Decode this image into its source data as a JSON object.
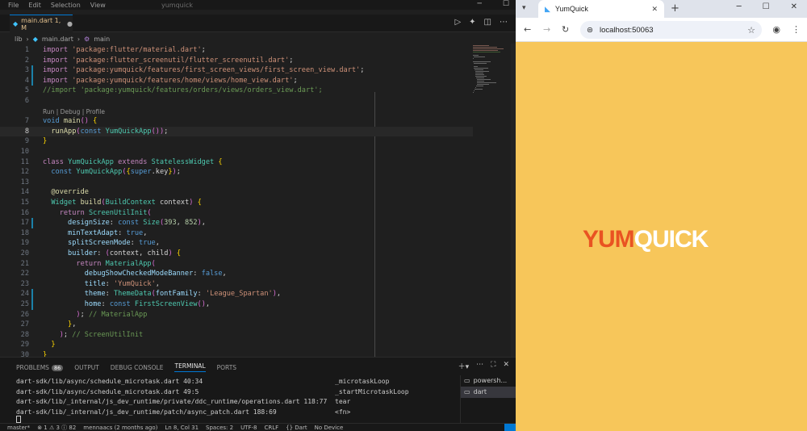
{
  "vscode": {
    "menu": [
      "File",
      "Edit",
      "Selection",
      "View"
    ],
    "command_center": "yumquick",
    "tab": {
      "label": "main.dart 1, M"
    },
    "breadcrumb": {
      "folder": "lib",
      "file": "main.dart",
      "symbol": "main"
    },
    "codelens": "Run | Debug | Profile",
    "code_lines": [
      {
        "n": "1",
        "text": "import 'package:flutter/material.dart';"
      },
      {
        "n": "2",
        "text": "import 'package:flutter_screenutil/flutter_screenutil.dart';"
      },
      {
        "n": "3",
        "text": "import 'package:yumquick/features/first_screen_views/first_screen_view.dart';"
      },
      {
        "n": "4",
        "text": "import 'package:yumquick/features/home/views/home_view.dart';"
      },
      {
        "n": "5",
        "text": "//import 'package:yumquick/features/orders/views/orders_view.dart';"
      },
      {
        "n": "6",
        "text": ""
      },
      {
        "n": "7",
        "text": "void main() {"
      },
      {
        "n": "8",
        "text": "  runApp(const YumQuickApp());"
      },
      {
        "n": "9",
        "text": "}"
      },
      {
        "n": "10",
        "text": ""
      },
      {
        "n": "11",
        "text": "class YumQuickApp extends StatelessWidget {"
      },
      {
        "n": "12",
        "text": "  const YumQuickApp({super.key});"
      },
      {
        "n": "13",
        "text": ""
      },
      {
        "n": "14",
        "text": "  @override"
      },
      {
        "n": "15",
        "text": "  Widget build(BuildContext context) {"
      },
      {
        "n": "16",
        "text": "    return ScreenUtilInit("
      },
      {
        "n": "17",
        "text": "      designSize: const Size(393, 852),"
      },
      {
        "n": "18",
        "text": "      minTextAdapt: true,"
      },
      {
        "n": "19",
        "text": "      splitScreenMode: true,"
      },
      {
        "n": "20",
        "text": "      builder: (context, child) {"
      },
      {
        "n": "21",
        "text": "        return MaterialApp("
      },
      {
        "n": "22",
        "text": "          debugShowCheckedModeBanner: false,"
      },
      {
        "n": "23",
        "text": "          title: 'YumQuick',"
      },
      {
        "n": "24",
        "text": "          theme: ThemeData(fontFamily: 'League_Spartan'),"
      },
      {
        "n": "25",
        "text": "          home: const FirstScreenView(),"
      },
      {
        "n": "26",
        "text": "        ); // MaterialApp"
      },
      {
        "n": "27",
        "text": "      },"
      },
      {
        "n": "28",
        "text": "    ); // ScreenUtilInit"
      },
      {
        "n": "29",
        "text": "  }"
      },
      {
        "n": "30",
        "text": "}"
      }
    ],
    "panel": {
      "tabs": [
        "PROBLEMS",
        "OUTPUT",
        "DEBUG CONSOLE",
        "TERMINAL",
        "PORTS"
      ],
      "problems_count": "86",
      "active_tab": "TERMINAL",
      "terminal_lines": [
        {
          "left": "dart-sdk/lib/async/schedule_microtask.dart 40:34",
          "right": "_microtaskLoop"
        },
        {
          "left": "dart-sdk/lib/async/schedule_microtask.dart 49:5",
          "right": "_startMicrotaskLoop"
        },
        {
          "left": "dart-sdk/lib/_internal/js_dev_runtime/private/ddc_runtime/operations.dart 118:77",
          "right": "tear"
        },
        {
          "left": "dart-sdk/lib/_internal/js_dev_runtime/patch/async_patch.dart 188:69",
          "right": "<fn>"
        }
      ],
      "terminal_list": [
        "powersh...",
        "dart"
      ]
    },
    "statusbar": [
      "master*",
      "⊗ 1 ⚠ 3 ⓘ 82",
      "mennaacs (2 months ago)",
      "Ln 8, Col 31",
      "Spaces: 2",
      "UTF-8",
      "CRLF",
      "{} Dart",
      "No Device"
    ]
  },
  "chrome": {
    "tab_title": "YumQuick",
    "url": "localhost:50063",
    "page_bg": "#f7c65a",
    "logo": {
      "part1": "YUM",
      "part2": "QUICK",
      "color1": "#e95322",
      "color2": "#ffffff"
    }
  }
}
